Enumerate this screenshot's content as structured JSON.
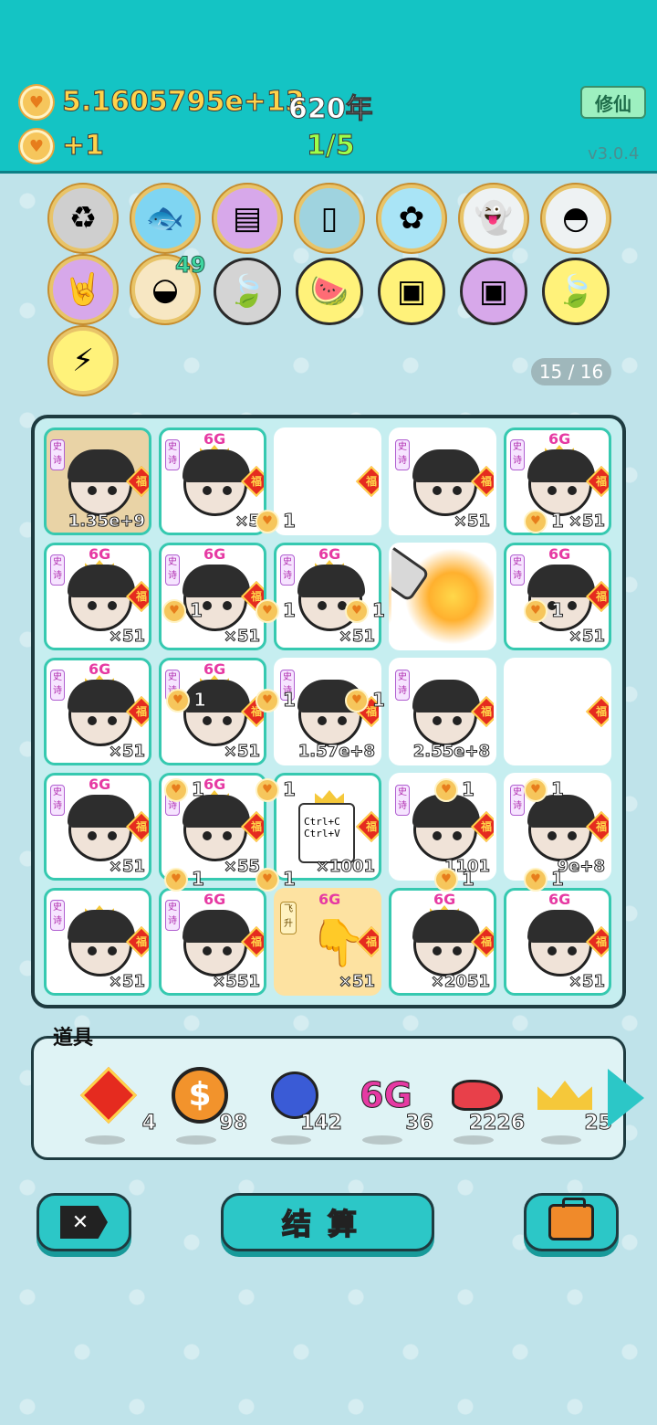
{
  "header": {
    "coins": "5.1605795e+13",
    "years": "620年",
    "income": "+1",
    "progress": "1/5",
    "cultivate_label": "修仙",
    "version": "v3.0.4"
  },
  "skills": {
    "badge": "49",
    "items": [
      "trash-bag",
      "fish-tank",
      "skirt",
      "tea-bag",
      "flower-pot",
      "ghost",
      "rice-cooker",
      "rock-hand",
      "shell",
      "leaf",
      "fruit-basket",
      "card-pack-orange",
      "card-pack-purple",
      "green-leaf",
      "lightning"
    ]
  },
  "page_count": "15 / 16",
  "board": {
    "cells": [
      {
        "count": "1.35e+9"
      },
      {
        "count": "×5"
      },
      {
        "count": ""
      },
      {
        "count": "×51"
      },
      {
        "count": "×51"
      },
      {
        "count": "×51"
      },
      {
        "count": "×51"
      },
      {
        "count": "×51"
      },
      {
        "count": ""
      },
      {
        "count": "×51"
      },
      {
        "count": "×51"
      },
      {
        "count": "×51"
      },
      {
        "count": "1.57e+8"
      },
      {
        "count": "2.55e+8"
      },
      {
        "count": ""
      },
      {
        "count": "×51"
      },
      {
        "count": "×55"
      },
      {
        "count": "×1001"
      },
      {
        "count": "1101"
      },
      {
        "count": "9e+8"
      },
      {
        "count": "×51"
      },
      {
        "count": "×551"
      },
      {
        "count": "×51"
      },
      {
        "count": "×2051"
      },
      {
        "count": "×51"
      }
    ],
    "heart_value": "1",
    "tag_6g": "6G",
    "tag_epic": "史诗",
    "tag_fu": "福",
    "tag_fly": "飞升",
    "ctrl_text": "Ctrl+C Ctrl+V"
  },
  "items": {
    "title": "道具",
    "list": [
      {
        "icon": "fu-diamond-icon",
        "count": "4"
      },
      {
        "icon": "dollar-coin-icon",
        "count": "98"
      },
      {
        "icon": "blueberry-icon",
        "count": "142"
      },
      {
        "icon": "6g-icon",
        "label": "6G",
        "count": "36"
      },
      {
        "icon": "liver-icon",
        "count": "2226"
      },
      {
        "icon": "crown-icon",
        "count": "25"
      }
    ]
  },
  "buttons": {
    "settle": "结算"
  },
  "colors": {
    "header_bg": "#14c4c4",
    "board_border": "#1e3b40",
    "accent": "#2cc7c7",
    "coin": "#f6c65c"
  }
}
